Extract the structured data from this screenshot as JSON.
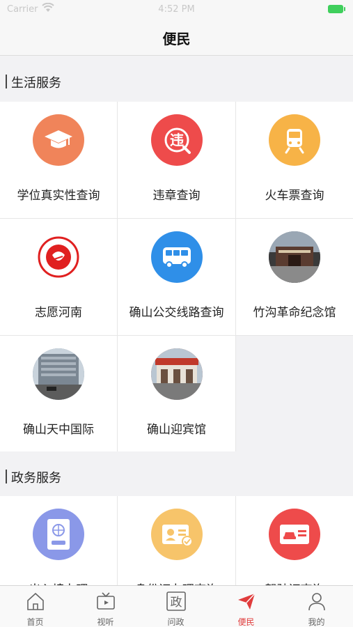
{
  "status_bar": {
    "carrier": "Carrier",
    "time": "4:52 PM"
  },
  "header": {
    "title": "便民"
  },
  "sections": {
    "life": {
      "title": "生活服务",
      "items": [
        {
          "label": "学位真实性查询",
          "icon": "graduation-cap-icon",
          "color": "#f0845a"
        },
        {
          "label": "违章查询",
          "icon": "violation-icon",
          "color": "#ee4b4b"
        },
        {
          "label": "火车票查询",
          "icon": "train-icon",
          "color": "#f7b347"
        },
        {
          "label": "志愿河南",
          "icon": "volunteer-logo-icon",
          "color": "#e02020"
        },
        {
          "label": "确山公交线路查询",
          "icon": "bus-icon",
          "color": "#2f8fe8"
        },
        {
          "label": "竹沟革命纪念馆",
          "icon": "memorial-hall-photo",
          "color": "#555555"
        },
        {
          "label": "确山天中国际",
          "icon": "hotel-building-photo",
          "color": "#7a8a9a"
        },
        {
          "label": "确山迎宾馆",
          "icon": "guesthouse-photo",
          "color": "#a04a3a"
        }
      ]
    },
    "gov": {
      "title": "政务服务",
      "items": [
        {
          "label": "出入境办理",
          "icon": "passport-icon",
          "color": "#8a98e8"
        },
        {
          "label": "身份证办理查询",
          "icon": "id-card-icon",
          "color": "#f7c46a"
        },
        {
          "label": "驾驶证查询",
          "icon": "driver-license-icon",
          "color": "#ee4b4b"
        }
      ]
    }
  },
  "tabs": [
    {
      "label": "首页",
      "icon": "home-icon"
    },
    {
      "label": "视听",
      "icon": "tv-icon"
    },
    {
      "label": "问政",
      "icon": "government-icon",
      "glyph": "政"
    },
    {
      "label": "便民",
      "icon": "paper-plane-icon",
      "active": true
    },
    {
      "label": "我的",
      "icon": "user-icon"
    }
  ],
  "colors": {
    "accent": "#e03c3c",
    "background": "#f2f2f4"
  }
}
